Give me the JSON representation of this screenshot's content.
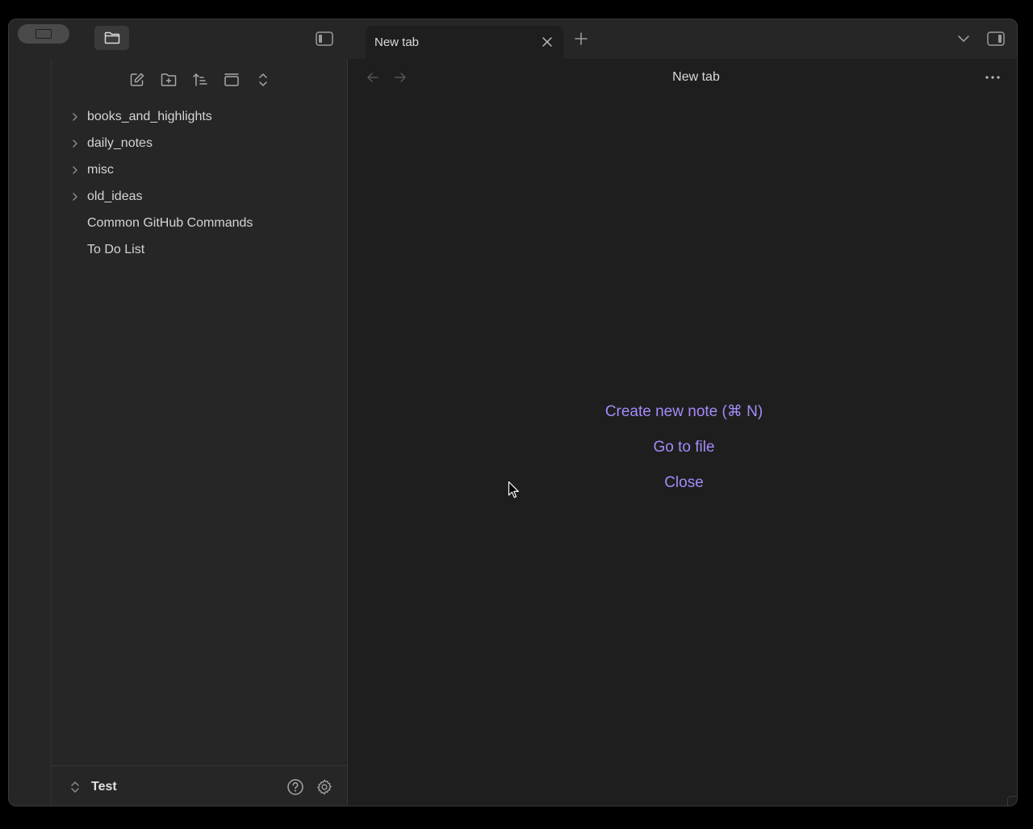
{
  "titlebar": {
    "tab_title": "New tab"
  },
  "sidebar": {
    "tree": [
      {
        "label": "books_and_highlights",
        "type": "folder"
      },
      {
        "label": "daily_notes",
        "type": "folder"
      },
      {
        "label": "misc",
        "type": "folder"
      },
      {
        "label": "old_ideas",
        "type": "folder"
      },
      {
        "label": "Common GitHub Commands",
        "type": "file"
      },
      {
        "label": "To Do List",
        "type": "file"
      }
    ],
    "vault_name": "Test"
  },
  "main": {
    "view_title": "New tab",
    "actions": {
      "create_note": "Create new note (⌘ N)",
      "go_to_file": "Go to file",
      "close": "Close"
    }
  },
  "colors": {
    "accent": "#a68af9",
    "background": "#1e1e1e",
    "sidebar_bg": "#262626"
  }
}
